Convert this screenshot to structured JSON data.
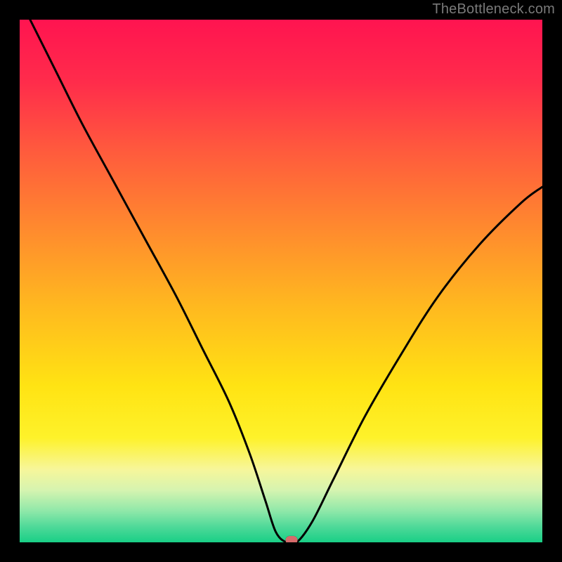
{
  "watermark": "TheBottleneck.com",
  "chart_data": {
    "type": "line",
    "title": "",
    "xlabel": "",
    "ylabel": "",
    "xlim": [
      0,
      100
    ],
    "ylim": [
      0,
      100
    ],
    "series": [
      {
        "name": "bottleneck-curve",
        "x": [
          2,
          7,
          12,
          18,
          24,
          30,
          35,
          40,
          44,
          47,
          49,
          51,
          53,
          56,
          60,
          66,
          73,
          80,
          88,
          96,
          100
        ],
        "values": [
          100,
          90,
          80,
          69,
          58,
          47,
          37,
          27,
          17,
          8,
          2,
          0,
          0,
          4,
          12,
          24,
          36,
          47,
          57,
          65,
          68
        ]
      }
    ],
    "marker": {
      "x": 52,
      "y": 0
    },
    "gradient_stops": [
      {
        "pos": 0.0,
        "color": "#ff1450"
      },
      {
        "pos": 0.12,
        "color": "#ff2c4b"
      },
      {
        "pos": 0.25,
        "color": "#ff5a3d"
      },
      {
        "pos": 0.4,
        "color": "#ff8a2e"
      },
      {
        "pos": 0.55,
        "color": "#ffb91f"
      },
      {
        "pos": 0.7,
        "color": "#ffe313"
      },
      {
        "pos": 0.8,
        "color": "#fef22a"
      },
      {
        "pos": 0.86,
        "color": "#f7f69a"
      },
      {
        "pos": 0.9,
        "color": "#d6f4b0"
      },
      {
        "pos": 0.94,
        "color": "#8fe8a9"
      },
      {
        "pos": 0.97,
        "color": "#4fd999"
      },
      {
        "pos": 1.0,
        "color": "#19cf86"
      }
    ]
  }
}
